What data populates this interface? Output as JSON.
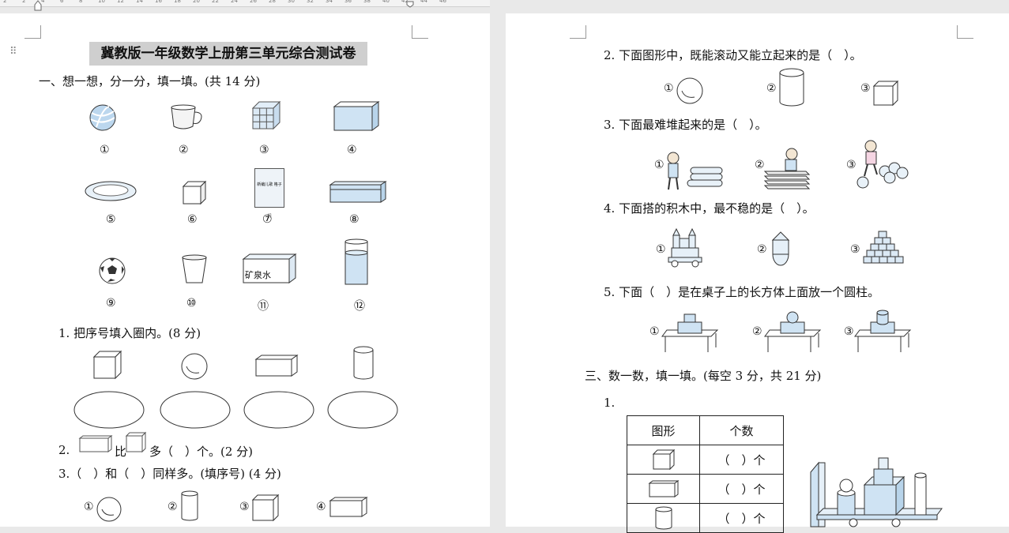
{
  "ruler": {
    "ticks": [
      "2",
      "2",
      "4",
      "6",
      "8",
      "10",
      "12",
      "14",
      "16",
      "18",
      "20",
      "22",
      "24",
      "26",
      "28",
      "30",
      "32",
      "34",
      "36",
      "38",
      "40",
      "42",
      "44",
      "46"
    ]
  },
  "left": {
    "title": "冀教版一年级数学上册第三单元综合测试卷",
    "section1": "一、想一想，分一分，填一填。(共 14 分)",
    "objects": [
      {
        "icon": "ball-icon",
        "label": "①"
      },
      {
        "icon": "cup-icon",
        "label": "②"
      },
      {
        "icon": "rubik-cube-icon",
        "label": "③"
      },
      {
        "icon": "open-box-icon",
        "label": "④"
      },
      {
        "icon": "plate-icon",
        "label": "⑤"
      },
      {
        "icon": "cube-icon",
        "label": "⑥"
      },
      {
        "icon": "book-icon",
        "label": "⑦"
      },
      {
        "icon": "pencil-box-icon",
        "label": "⑧"
      },
      {
        "icon": "soccer-ball-icon",
        "label": "⑨"
      },
      {
        "icon": "paper-cup-icon",
        "label": "⑩"
      },
      {
        "icon": "water-box-icon",
        "label": "⑪"
      },
      {
        "icon": "glass-icon",
        "label": "⑫"
      }
    ],
    "book_text": "新编儿歌 格子们",
    "water_box_text": "矿泉水",
    "q1": "1. 把序号填入圈内。(8 分)",
    "q2_a": "2.",
    "q2_b": "比",
    "q2_c": "多（　）个。(2 分)",
    "q3": "3.（　）和（　）同样多。(填序号) (4 分)",
    "q3_labels": [
      "①",
      "②",
      "③",
      "④"
    ]
  },
  "right": {
    "q2": "2. 下面图形中，既能滚动又能立起来的是（　）。",
    "q2_labels": [
      "①",
      "②",
      "③"
    ],
    "q3": "3. 下面最难堆起来的是（　）。",
    "q3_labels": [
      "①",
      "②",
      "③"
    ],
    "q4": "4. 下面搭的积木中，最不稳的是（　）。",
    "q4_labels": [
      "①",
      "②",
      "③"
    ],
    "q5": "5. 下面（　）是在桌子上的长方体上面放一个圆柱。",
    "q5_labels": [
      "①",
      "②",
      "③"
    ],
    "section3": "三、数一数，填一填。(每空 3 分，共 21 分)",
    "s3_q1": "1.",
    "table": {
      "headers": [
        "图形",
        "个数"
      ],
      "rows": [
        "（　）个",
        "（　）个",
        "（　）个"
      ]
    }
  },
  "colors": {
    "fill": "#cfe3f3",
    "stroke": "#333333",
    "title_bg": "#cfcfcf"
  }
}
